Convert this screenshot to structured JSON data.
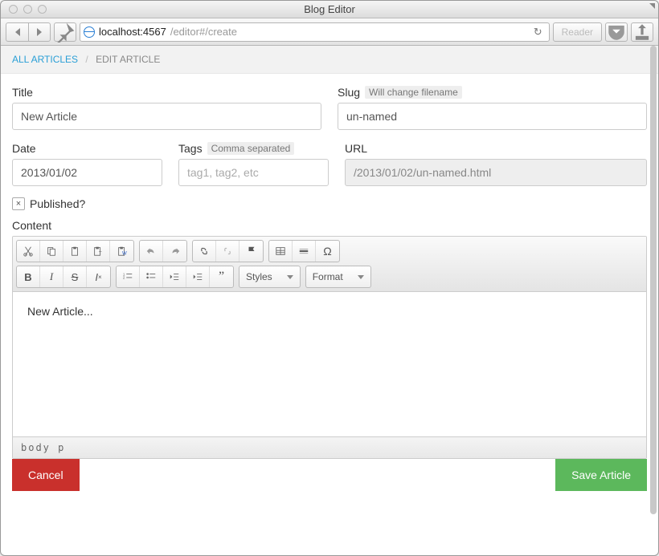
{
  "window": {
    "title": "Blog Editor"
  },
  "browser": {
    "url_host": "localhost:4567",
    "url_path": "/editor#/create",
    "reader_label": "Reader"
  },
  "breadcrumb": {
    "all": "ALL ARTICLES",
    "sep": "/",
    "current": "EDIT ARTICLE"
  },
  "fields": {
    "title": {
      "label": "Title",
      "value": "New Article"
    },
    "slug": {
      "label": "Slug",
      "hint": "Will change filename",
      "value": "un-named"
    },
    "date": {
      "label": "Date",
      "value": "2013/01/02"
    },
    "tags": {
      "label": "Tags",
      "hint": "Comma separated",
      "placeholder": "tag1, tag2, etc",
      "value": ""
    },
    "url": {
      "label": "URL",
      "value": "/2013/01/02/un-named.html"
    },
    "published": {
      "label": "Published?",
      "checked": true
    },
    "content": {
      "label": "Content",
      "body": "New Article..."
    }
  },
  "editor": {
    "styles_label": "Styles",
    "format_label": "Format",
    "status_path": "body  p"
  },
  "actions": {
    "cancel": "Cancel",
    "save": "Save Article"
  }
}
